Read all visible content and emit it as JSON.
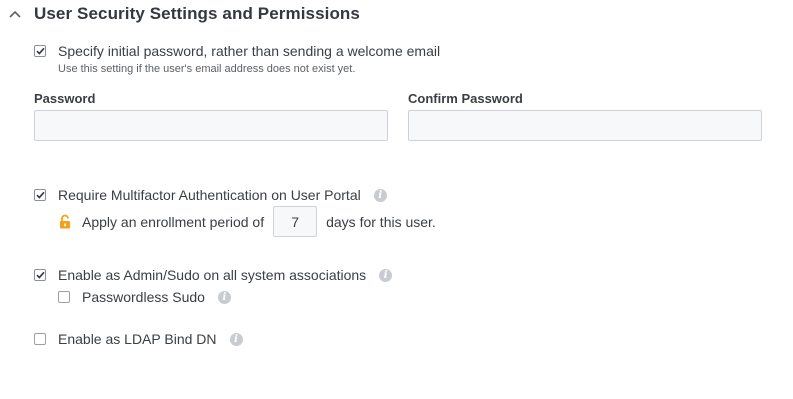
{
  "section": {
    "title": "User Security Settings and Permissions",
    "expanded": true
  },
  "initial_password": {
    "checked": true,
    "label": "Specify initial password, rather than sending a welcome email",
    "help": "Use this setting if the user's email address does not exist yet."
  },
  "password_field": {
    "label": "Password",
    "value": ""
  },
  "confirm_password_field": {
    "label": "Confirm Password",
    "value": ""
  },
  "mfa": {
    "checked": true,
    "label": "Require Multifactor Authentication on User Portal",
    "enrollment_prefix": "Apply an enrollment period of",
    "enrollment_days": "7",
    "enrollment_suffix": "days for this user."
  },
  "admin_sudo": {
    "checked": true,
    "label": "Enable as Admin/Sudo on all system associations"
  },
  "passwordless_sudo": {
    "checked": false,
    "label": "Passwordless Sudo"
  },
  "ldap_bind": {
    "checked": false,
    "label": "Enable as LDAP Bind DN"
  },
  "colors": {
    "lock_icon": "#f0a21b",
    "info_icon": "#c8ccd0",
    "input_bg": "#f7f8f9"
  }
}
